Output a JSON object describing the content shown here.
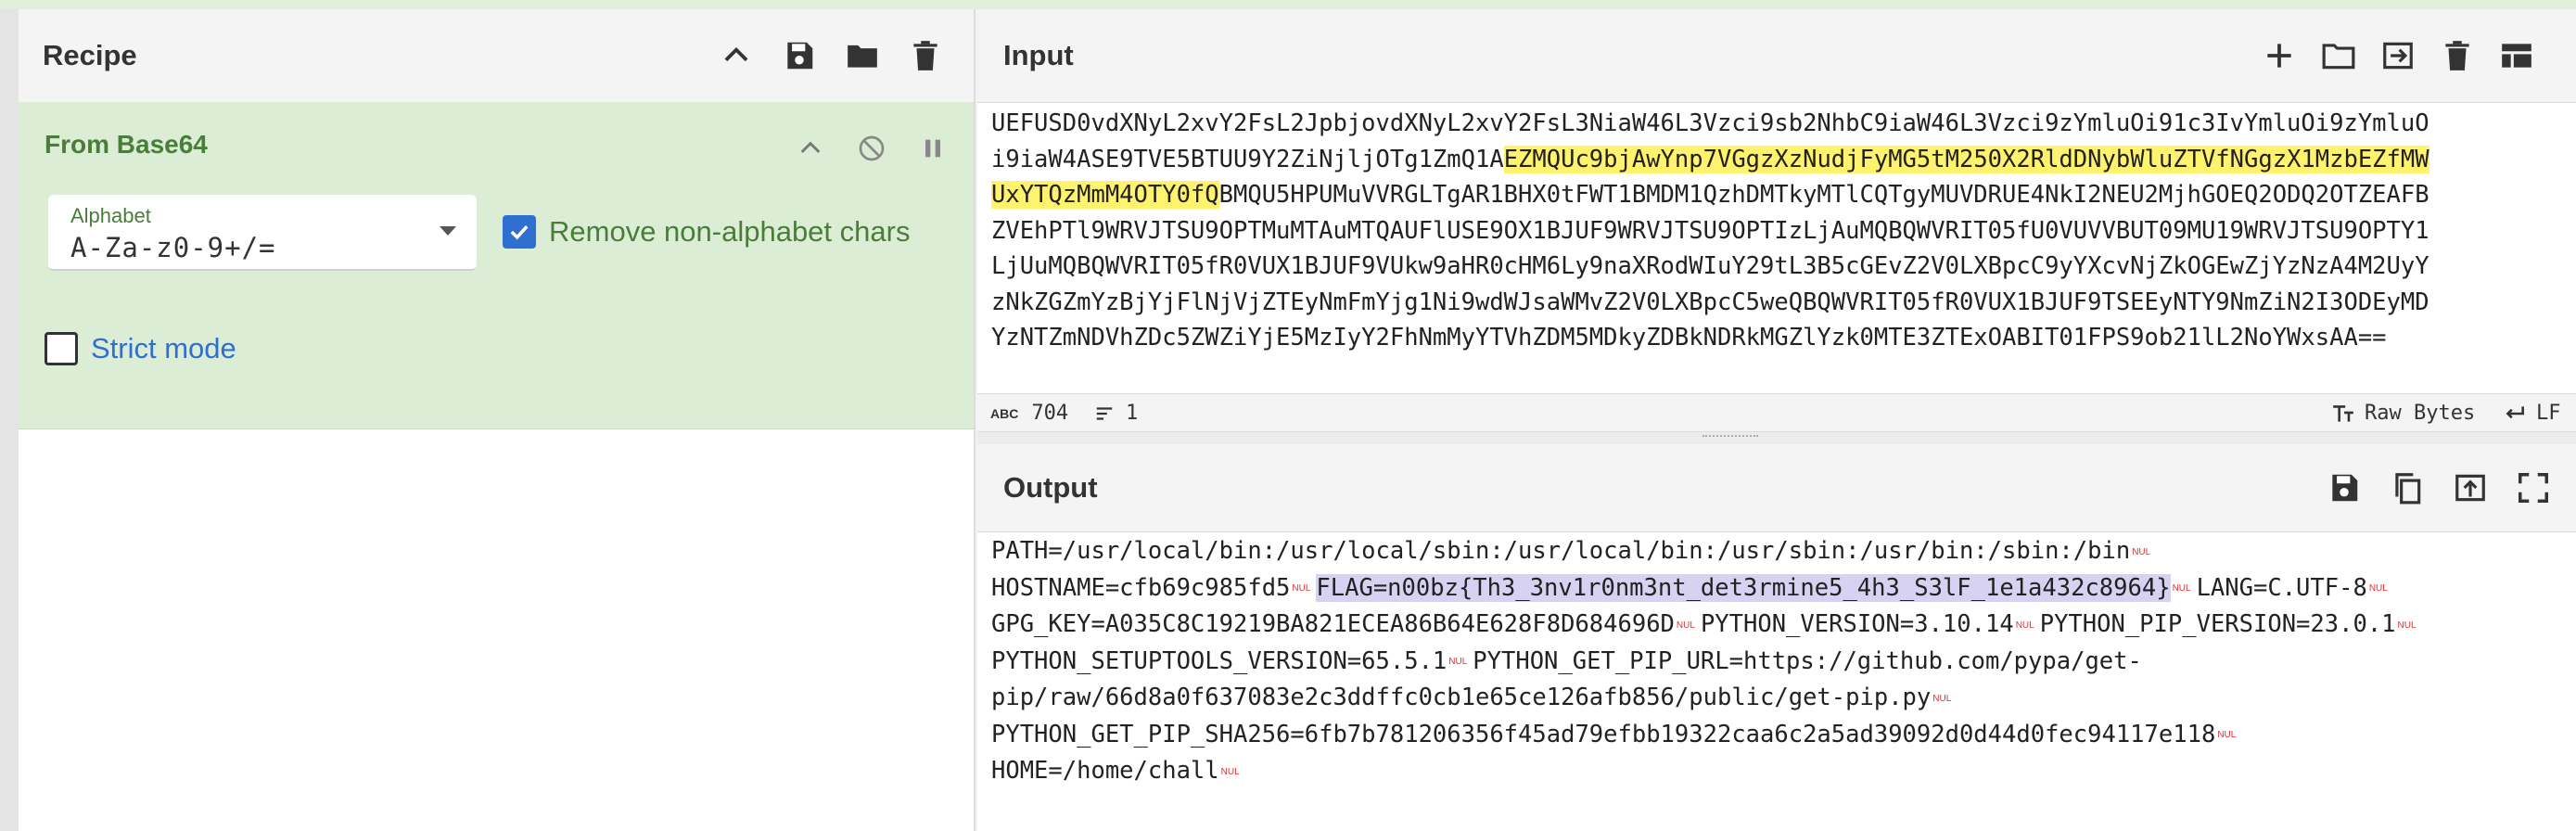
{
  "recipe": {
    "title": "Recipe",
    "operation": {
      "name": "From Base64",
      "alphabet_label": "Alphabet",
      "alphabet_value": "A-Za-z0-9+/=",
      "remove_non_alphabet_label": "Remove non-alphabet chars",
      "remove_non_alphabet_checked": true,
      "strict_mode_label": "Strict mode",
      "strict_mode_checked": false
    }
  },
  "input": {
    "title": "Input",
    "lines": [
      "UEFUSD0vdXNyL2xvY2FsL2JpbjovdXNyL2xvY2FsL3NiaW46L3Vzci9sb2NhbC9iaW46L3Vzci9zYmluOi91c3IvYmluOi9zYmluO",
      "i9iaW4ASE9TVE5BTUU9Y2ZiNjljOTg1ZmQ1A",
      "EZMQUc9bjAwYnp7VGgzXzNudjFyMG5tM250X2RldDNybWluZTVfNGgzX1MzbEZfMW",
      "UxYTQzMmM4OTY0fQ",
      "BMQU5HPUMuVVRGLTgAR1BHX0tFWT1BMDM1QzhDMTkyMTlCQTgyMUVDRUE4NkI2NEU2MjhGOEQ2ODQ2OTZEAFB",
      "ZVEhPTl9WRVJTSU9OPTMuMTAuMTQAUFlUSE9OX1BJUF9WRVJTSU9OPTIzLjAuMQBQWVRIT05fU0VUVVBUT09MU19WRVJTSU9OPTY1",
      "LjUuMQBQWVRIT05fR0VUX1BJUF9VUkw9aHR0cHM6Ly9naXRodWIuY29tL3B5cGEvZ2V0LXBpcC9yYXcvNjZkOGEwZjYzNzA4M2UyY",
      "zNkZGZmYzBjYjFlNjVjZTEyNmFmYjg1Ni9wdWJsaWMvZ2V0LXBpcC5weQBQWVRIT05fR0VUX1BJUF9TSEEyNTY9NmZiN2I3ODEyMD",
      "YzNTZmNDVhZDc5ZWZiYjE5MzIyY2FhNmMyYTVhZDM5MDkyZDBkNDRkMGZlYzk0MTE3ZTExOABIT01FPS9ob21lL2NoYWxsAA=="
    ],
    "status": {
      "length_label": "ABC",
      "length": "704",
      "lines_count": "1",
      "encoding": "Raw Bytes",
      "eol": "LF"
    }
  },
  "output": {
    "title": "Output",
    "nul_symbol": "NUL",
    "segments": {
      "path": "PATH=/usr/local/bin:/usr/local/sbin:/usr/local/bin:/usr/sbin:/usr/bin:/sbin:/bin",
      "hostname": "HOSTNAME=cfb69c985fd5",
      "flag": "FLAG=n00bz{Th3_3nv1r0nm3nt_det3rmine5_4h3_S3lF_1e1a432c8964}",
      "lang": "LANG=C.UTF-8",
      "gpg": "GPG_KEY=A035C8C19219BA821ECEA86B64E628F8D684696D",
      "pyver": "PYTHON_VERSION=3.10.14",
      "pipver": "PYTHON_PIP_VERSION=23.0.1",
      "setuptools": "PYTHON_SETUPTOOLS_VERSION=65.5.1",
      "pipurl_a": "PYTHON_GET_PIP_URL=https://github.com/pypa/get-",
      "pipurl_b": "pip/raw/66d8a0f637083e2c3ddffc0cb1e65ce126afb856/public/get-pip.py",
      "sha": "PYTHON_GET_PIP_SHA256=6fb7b781206356f45ad79efbb19322caa6c2a5ad39092d0d44d0fec94117e118",
      "home": "HOME=/home/chall"
    }
  },
  "colors": {
    "operation_bg": "#dcedd6",
    "operation_text": "#4a7d3a",
    "checkbox_blue": "#2f6fcf",
    "highlight_yellow": "#fff36e",
    "highlight_purple": "#d7d2f2",
    "nul_red": "#e03030"
  },
  "icons": {
    "recipe_header": [
      "chevron-up-icon",
      "save-icon",
      "folder-icon",
      "trash-icon"
    ],
    "operation": [
      "chevron-up-icon",
      "disable-icon",
      "pause-icon"
    ],
    "input_header": [
      "plus-icon",
      "folder-icon",
      "import-icon",
      "trash-icon",
      "layout-icon"
    ],
    "output_header": [
      "save-icon",
      "copy-icon",
      "replace-input-icon",
      "maximize-icon"
    ]
  }
}
